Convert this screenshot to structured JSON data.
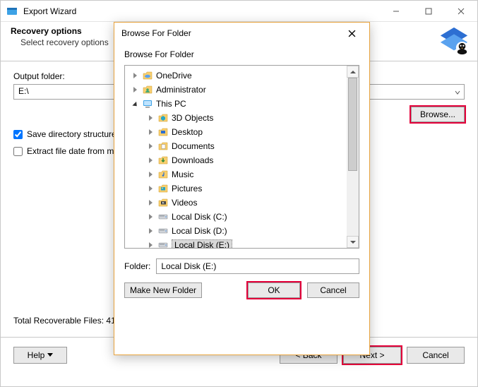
{
  "window": {
    "title": "Export Wizard",
    "heading": "Recovery options",
    "subheading": "Select recovery options"
  },
  "form": {
    "output_folder_label": "Output folder:",
    "output_folder_value": "E:\\",
    "browse_label": "Browse...",
    "save_dir_structure_label": "Save directory structure",
    "save_dir_structure_checked": true,
    "extract_file_date_label": "Extract file date from m",
    "extract_file_date_checked": false,
    "total_recoverable": "Total Recoverable Files: 41"
  },
  "footer": {
    "help_label": "Help",
    "back_label": "< Back",
    "next_label": "Next >",
    "cancel_label": "Cancel"
  },
  "modal": {
    "title": "Browse For Folder",
    "instruction": "Browse For Folder",
    "folder_label": "Folder:",
    "folder_value": "Local Disk (E:)",
    "make_new_folder_label": "Make New Folder",
    "ok_label": "OK",
    "cancel_label": "Cancel",
    "tree": [
      {
        "depth": 0,
        "expanded": false,
        "icon": "folder-cloud",
        "label": "OneDrive",
        "selected": false
      },
      {
        "depth": 0,
        "expanded": false,
        "icon": "folder-user",
        "label": "Administrator",
        "selected": false
      },
      {
        "depth": 0,
        "expanded": true,
        "icon": "this-pc",
        "label": "This PC",
        "selected": false
      },
      {
        "depth": 1,
        "expanded": false,
        "icon": "folder-3d",
        "label": "3D Objects",
        "selected": false
      },
      {
        "depth": 1,
        "expanded": false,
        "icon": "folder-desktop",
        "label": "Desktop",
        "selected": false
      },
      {
        "depth": 1,
        "expanded": false,
        "icon": "folder-doc",
        "label": "Documents",
        "selected": false
      },
      {
        "depth": 1,
        "expanded": false,
        "icon": "folder-down",
        "label": "Downloads",
        "selected": false
      },
      {
        "depth": 1,
        "expanded": false,
        "icon": "folder-music",
        "label": "Music",
        "selected": false
      },
      {
        "depth": 1,
        "expanded": false,
        "icon": "folder-pic",
        "label": "Pictures",
        "selected": false
      },
      {
        "depth": 1,
        "expanded": false,
        "icon": "folder-video",
        "label": "Videos",
        "selected": false
      },
      {
        "depth": 1,
        "expanded": false,
        "icon": "drive",
        "label": "Local Disk (C:)",
        "selected": false
      },
      {
        "depth": 1,
        "expanded": false,
        "icon": "drive",
        "label": "Local Disk (D:)",
        "selected": false
      },
      {
        "depth": 1,
        "expanded": false,
        "icon": "drive",
        "label": "Local Disk (E:)",
        "selected": true
      }
    ]
  },
  "colors": {
    "highlight_red": "#e4003a",
    "modal_border": "#e8a33d"
  }
}
